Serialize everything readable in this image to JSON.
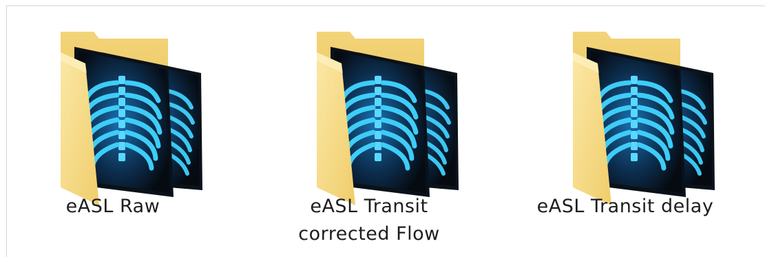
{
  "folders": [
    {
      "name": "eASL Raw",
      "icon": "xray-folder-icon"
    },
    {
      "name": "eASL Transit corrected Flow",
      "icon": "xray-folder-icon"
    },
    {
      "name": "eASL Transit delay",
      "icon": "xray-folder-icon"
    }
  ],
  "colors": {
    "folder_back": "#efcf6f",
    "folder_front": "#f8dd86",
    "film_dark": "#101820",
    "bone": "#39c8f5"
  }
}
